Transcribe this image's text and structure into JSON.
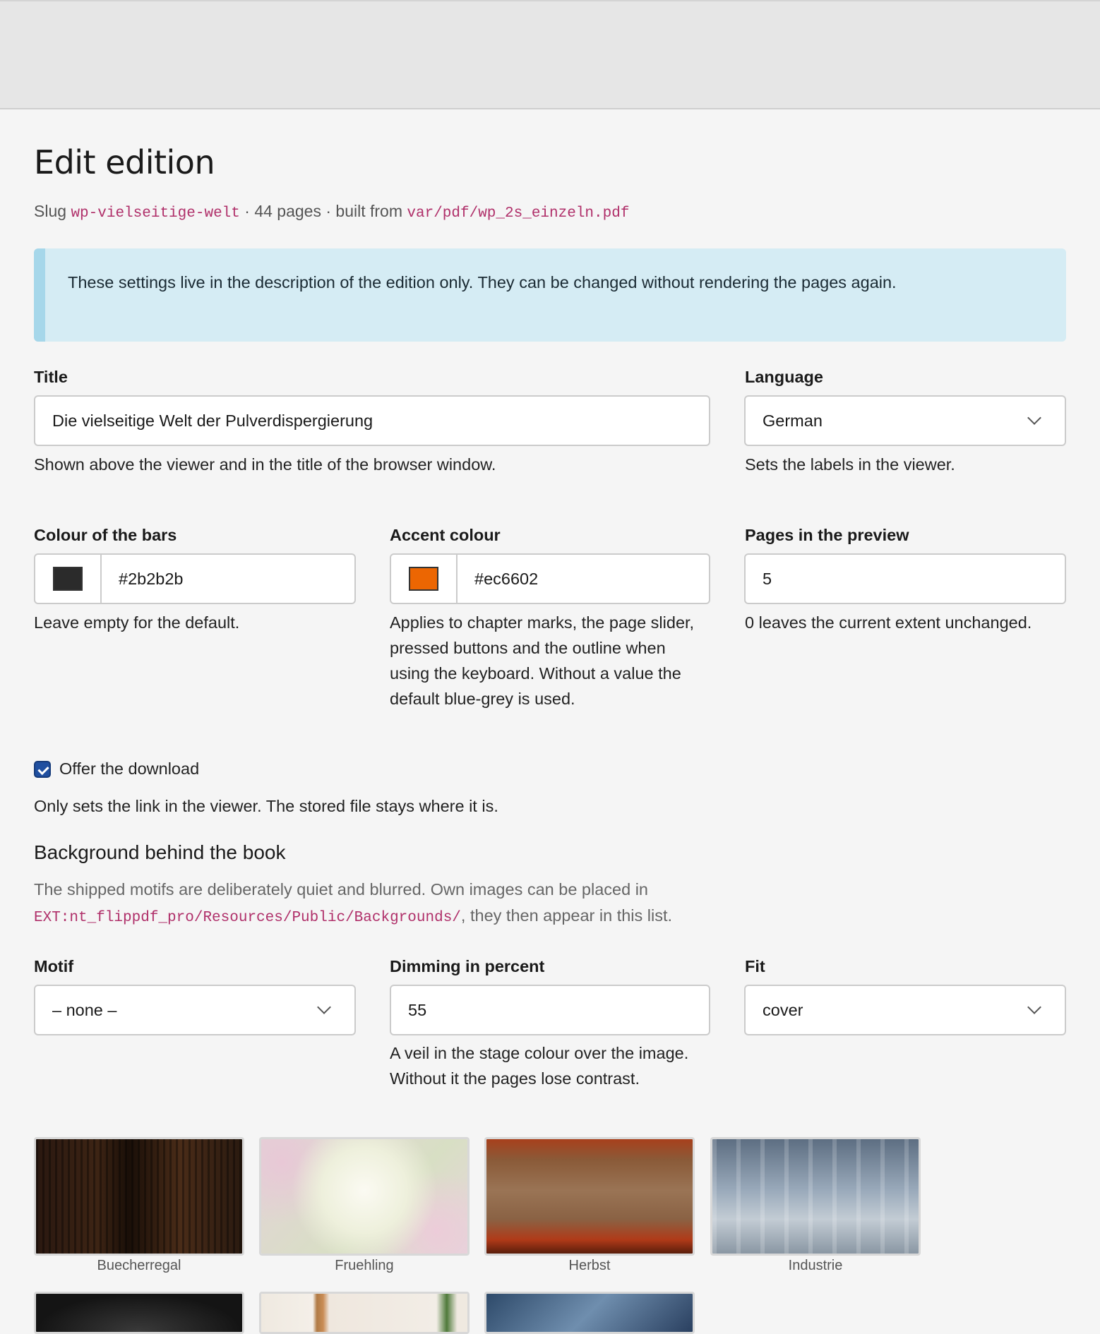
{
  "page": {
    "title": "Edit edition",
    "meta": {
      "slug_label": "Slug",
      "slug": "wp-vielseitige-welt",
      "pages_text": "· 44 pages · built from",
      "source_path": "var/pdf/wp_2s_einzeln.pdf"
    },
    "callout": "These settings live in the description of the edition only. They can be changed without rendering the pages again."
  },
  "form": {
    "title": {
      "label": "Title",
      "value": "Die vielseitige Welt der Pulverdispergierung",
      "help": "Shown above the viewer and in the title of the browser window."
    },
    "language": {
      "label": "Language",
      "value": "German",
      "help": "Sets the labels in the viewer."
    },
    "bar_colour": {
      "label": "Colour of the bars",
      "value": "#2b2b2b",
      "swatch": "#2b2b2b",
      "help": "Leave empty for the default."
    },
    "accent_colour": {
      "label": "Accent colour",
      "value": "#ec6602",
      "swatch": "#ec6602",
      "help_lines": [
        "Applies to chapter marks, the page slider,",
        "pressed buttons and the outline when",
        "using the keyboard. Without a value the",
        "default blue-grey is used."
      ]
    },
    "preview_pages": {
      "label": "Pages in the preview",
      "value": "5",
      "help": "0 leaves the current extent unchanged."
    },
    "download": {
      "label": "Offer the download",
      "checked": true,
      "help": "Only sets the link in the viewer. The stored file stays where it is."
    }
  },
  "background": {
    "title": "Background behind the book",
    "intro_line1": "The shipped motifs are deliberately quiet and blurred. Own images can be placed in",
    "intro_path": "EXT:nt_flippdf_pro/Resources/Public/Backgrounds/",
    "intro_line2_rest": ", they then appear in this list.",
    "motif": {
      "label": "Motif",
      "value": "– none –"
    },
    "dimming": {
      "label": "Dimming in percent",
      "value": "55",
      "help_lines": [
        "A veil in the stage colour over the image.",
        "Without it the pages lose contrast."
      ]
    },
    "fit": {
      "label": "Fit",
      "value": "cover"
    },
    "motifs": [
      {
        "name": "Buecherregal"
      },
      {
        "name": "Fruehling"
      },
      {
        "name": "Herbst"
      },
      {
        "name": "Industrie"
      }
    ]
  }
}
